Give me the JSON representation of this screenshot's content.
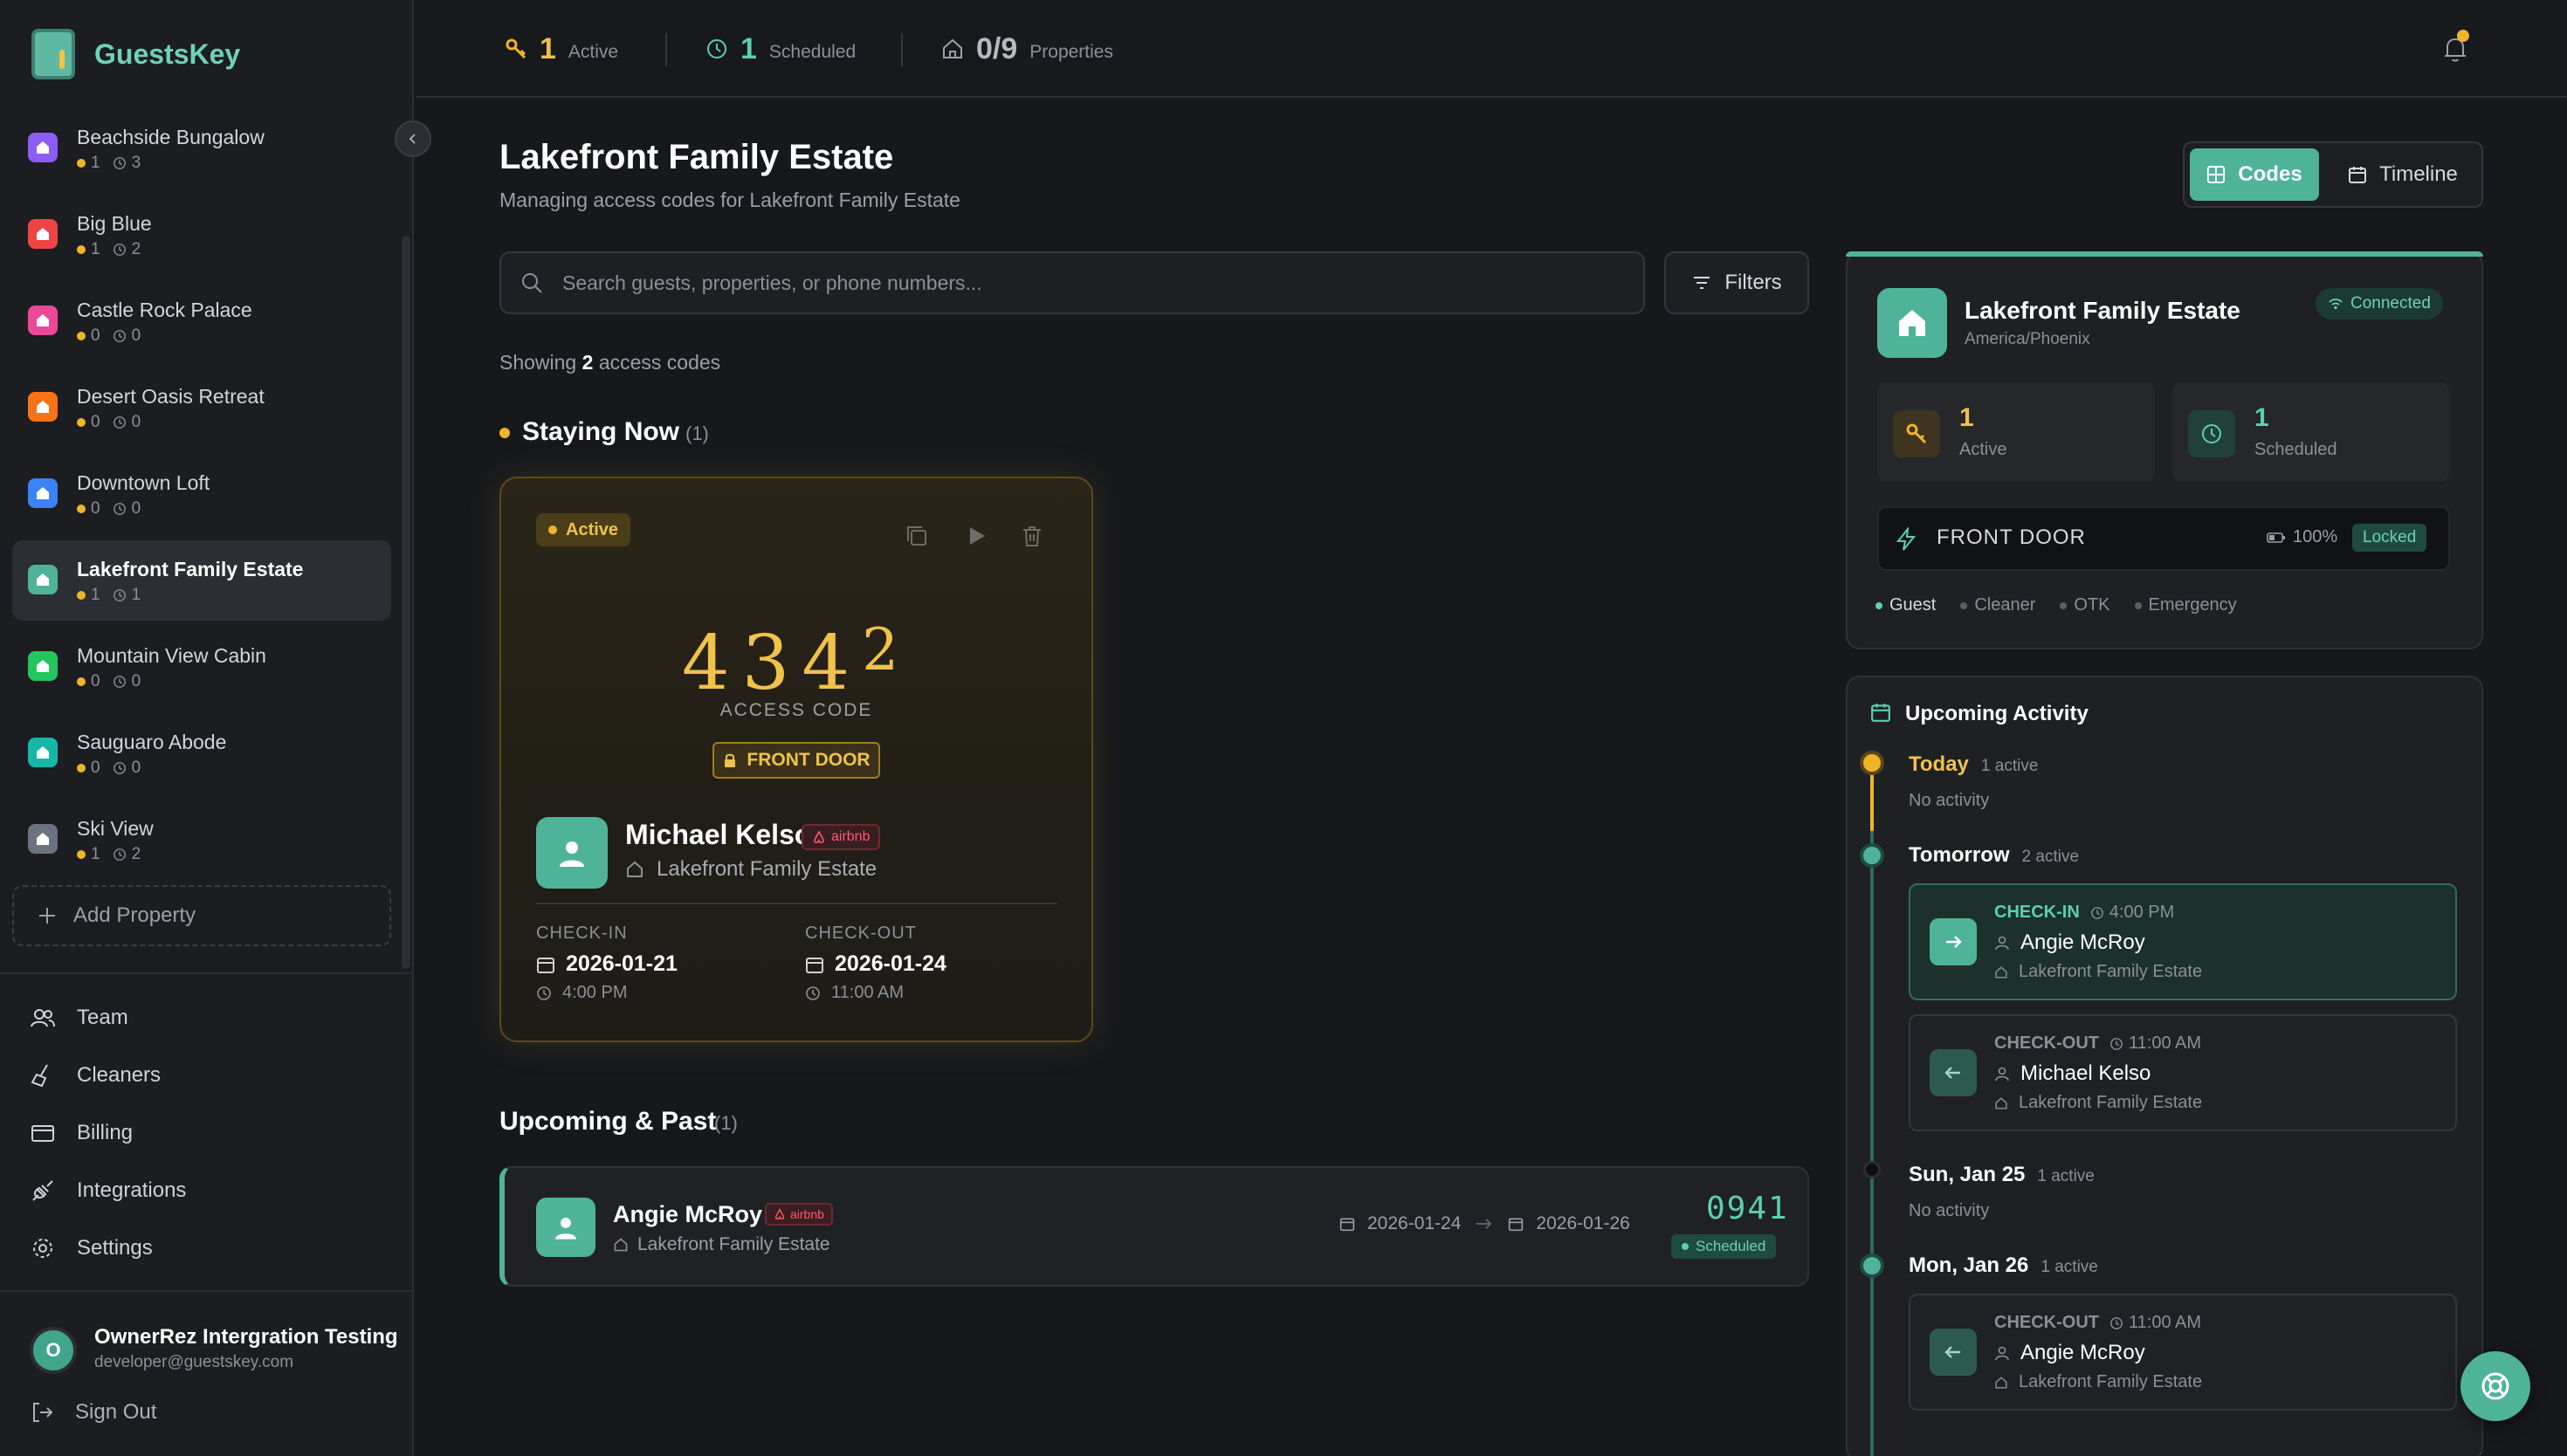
{
  "app": {
    "name": "GuestsKey"
  },
  "sidebar": {
    "properties": [
      {
        "name": "Beachside Bungalow",
        "active": "1",
        "scheduled": "3",
        "color": "#8b5cf6"
      },
      {
        "name": "Big Blue",
        "active": "1",
        "scheduled": "2",
        "color": "#ef4444"
      },
      {
        "name": "Castle Rock Palace",
        "active": "0",
        "scheduled": "0",
        "color": "#ec4899"
      },
      {
        "name": "Desert Oasis Retreat",
        "active": "0",
        "scheduled": "0",
        "color": "#f97316"
      },
      {
        "name": "Downtown Loft",
        "active": "0",
        "scheduled": "0",
        "color": "#3b82f6"
      },
      {
        "name": "Lakefront Family Estate",
        "active": "1",
        "scheduled": "1",
        "color": "#4fb39a"
      },
      {
        "name": "Mountain View Cabin",
        "active": "0",
        "scheduled": "0",
        "color": "#22c55e"
      },
      {
        "name": "Sauguaro Abode",
        "active": "0",
        "scheduled": "0",
        "color": "#14b8a6"
      },
      {
        "name": "Ski View",
        "active": "1",
        "scheduled": "2",
        "color": "#6b7280"
      }
    ],
    "add_property": "Add Property",
    "nav": [
      {
        "label": "Team",
        "icon": "team-icon"
      },
      {
        "label": "Cleaners",
        "icon": "broom-icon"
      },
      {
        "label": "Billing",
        "icon": "credit-card-icon"
      },
      {
        "label": "Integrations",
        "icon": "plug-icon"
      },
      {
        "label": "Settings",
        "icon": "gear-icon"
      }
    ],
    "user": {
      "initial": "O",
      "name": "OwnerRez Intergration Testing",
      "email": "developer@guestskey.com"
    },
    "sign_out": "Sign Out"
  },
  "topbar": {
    "active_count": "1",
    "active_label": "Active",
    "scheduled_count": "1",
    "scheduled_label": "Scheduled",
    "properties_count": "0/9",
    "properties_label": "Properties"
  },
  "main": {
    "title": "Lakefront Family Estate",
    "subtitle": "Managing access codes for Lakefront Family Estate",
    "view_codes": "Codes",
    "view_timeline": "Timeline",
    "search_placeholder": "Search guests, properties, or phone numbers...",
    "filters": "Filters",
    "showing_prefix": "Showing",
    "showing_count": "2",
    "showing_suffix": "access codes",
    "staying_now": {
      "title": "Staying Now",
      "count": "(1)"
    },
    "active_card": {
      "badge": "Active",
      "code_digits": [
        "4",
        "3",
        "4",
        "2"
      ],
      "code_label": "ACCESS CODE",
      "door": "FRONT DOOR",
      "guest": "Michael Kelso",
      "source": "airbnb",
      "property": "Lakefront Family Estate",
      "checkin_label": "CHECK-IN",
      "checkin_date": "2026-01-21",
      "checkin_time": "4:00 PM",
      "checkout_label": "CHECK-OUT",
      "checkout_date": "2026-01-24",
      "checkout_time": "11:00 AM"
    },
    "upcoming": {
      "title": "Upcoming & Past",
      "count": "(1)"
    },
    "upcoming_row": {
      "guest": "Angie McRoy",
      "source": "airbnb",
      "property": "Lakefront Family Estate",
      "start": "2026-01-24",
      "end": "2026-01-26",
      "code": "0941",
      "status": "Scheduled"
    }
  },
  "panel": {
    "property": {
      "name": "Lakefront Family Estate",
      "timezone": "America/Phoenix",
      "status": "Connected",
      "active_count": "1",
      "active_label": "Active",
      "scheduled_count": "1",
      "scheduled_label": "Scheduled",
      "door": "FRONT DOOR",
      "battery": "100%",
      "lock_state": "Locked",
      "legend": [
        "Guest",
        "Cleaner",
        "OTK",
        "Emergency"
      ]
    },
    "activity": {
      "title": "Upcoming Activity",
      "today": {
        "name": "Today",
        "count": "1 active",
        "note": "No activity"
      },
      "tomorrow": {
        "name": "Tomorrow",
        "count": "2 active"
      },
      "ev1": {
        "type": "CHECK-IN",
        "time": "4:00 PM",
        "guest": "Angie McRoy",
        "property": "Lakefront Family Estate"
      },
      "ev2": {
        "type": "CHECK-OUT",
        "time": "11:00 AM",
        "guest": "Michael Kelso",
        "property": "Lakefront Family Estate"
      },
      "sun": {
        "name": "Sun, Jan 25",
        "count": "1 active",
        "note": "No activity"
      },
      "mon": {
        "name": "Mon, Jan 26",
        "count": "1 active"
      },
      "ev3": {
        "type": "CHECK-OUT",
        "time": "11:00 AM",
        "guest": "Angie McRoy",
        "property": "Lakefront Family Estate"
      }
    }
  },
  "colors": {
    "accent": "#4fb39a",
    "active": "#f0b429",
    "airbnb": "#ff5a68"
  }
}
